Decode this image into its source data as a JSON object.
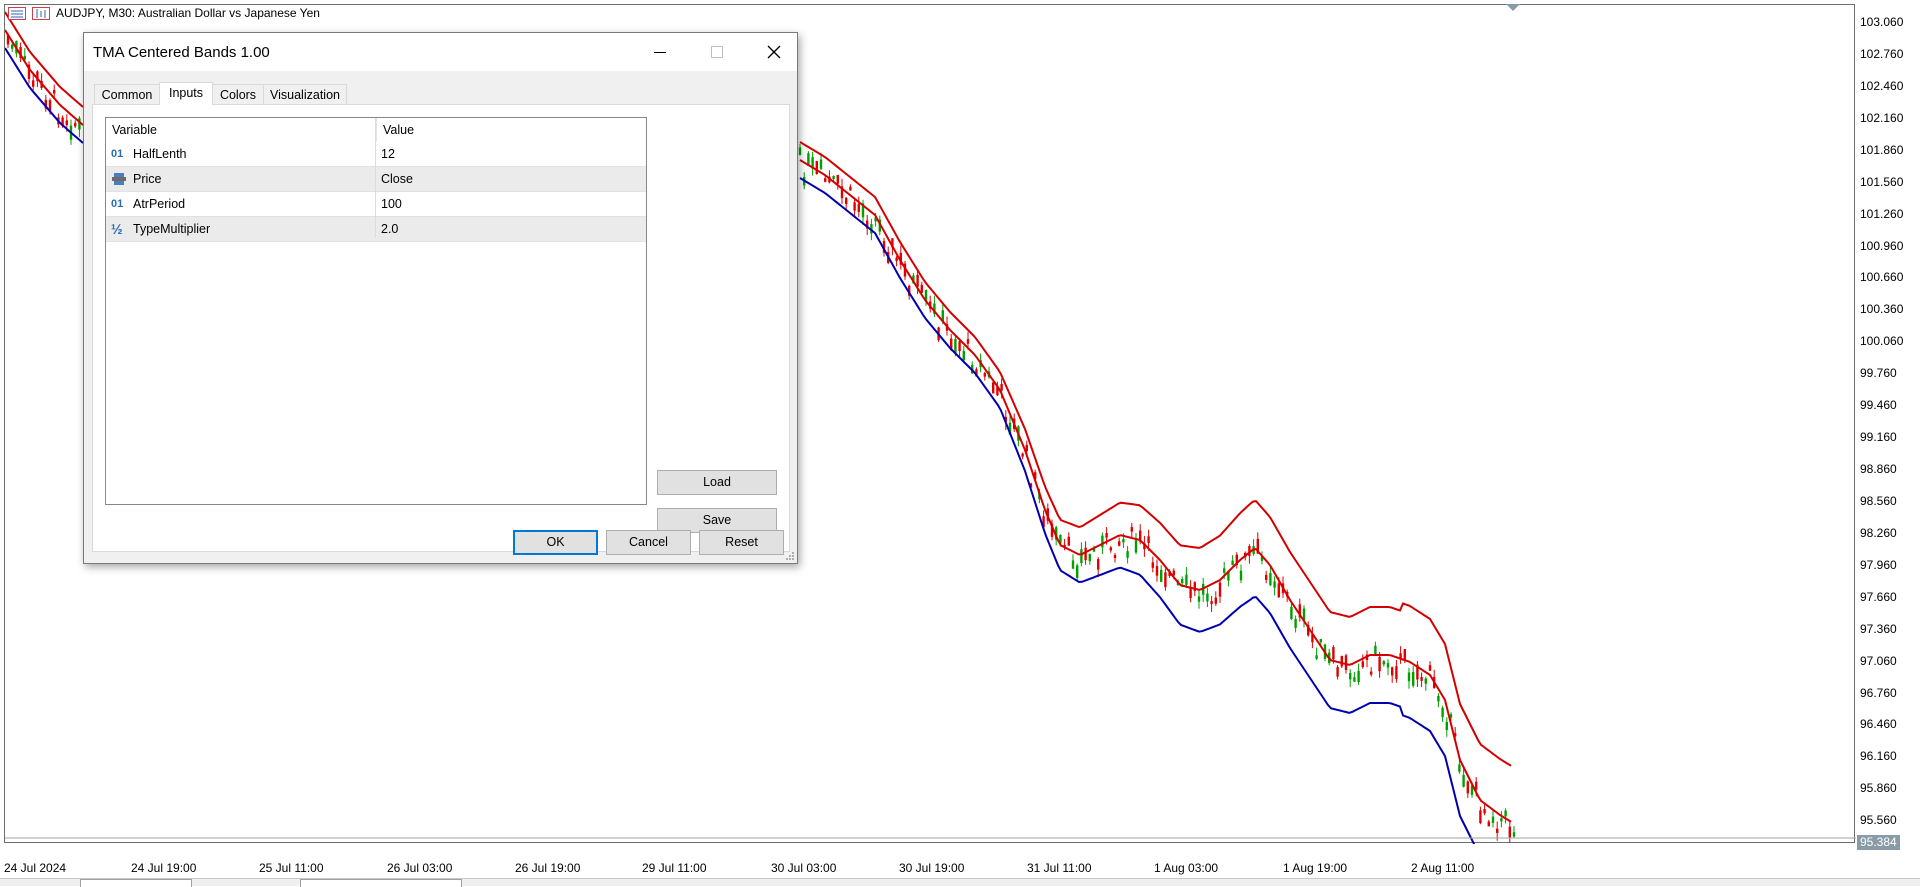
{
  "chart": {
    "symbol_title": "AUDJPY, M30:  Australian Dollar vs Japanese Yen",
    "current_price": "95.384",
    "price_labels": [
      "103.060",
      "102.760",
      "102.460",
      "102.160",
      "101.860",
      "101.560",
      "101.260",
      "100.960",
      "100.660",
      "100.360",
      "100.060",
      "99.760",
      "99.460",
      "99.160",
      "98.860",
      "98.560",
      "98.260",
      "97.960",
      "97.660",
      "97.360",
      "97.060",
      "96.760",
      "96.460",
      "96.160",
      "95.860",
      "95.560"
    ],
    "time_labels": [
      "24 Jul 2024",
      "24 Jul 19:00",
      "25 Jul 11:00",
      "26 Jul 03:00",
      "26 Jul 19:00",
      "29 Jul 11:00",
      "30 Jul 03:00",
      "30 Jul 19:00",
      "31 Jul 11:00",
      "1 Aug 03:00",
      "1 Aug 19:00",
      "2 Aug 11:00"
    ],
    "colors": {
      "bull": "#00a000",
      "bear": "#e00000",
      "upper_band": "#d40000",
      "middle_band": "#d40000",
      "lower_band": "#0000b0"
    }
  },
  "dialog": {
    "title": "TMA Centered Bands 1.00",
    "tabs": [
      {
        "label": "Common",
        "active": false
      },
      {
        "label": "Inputs",
        "active": true
      },
      {
        "label": "Colors",
        "active": false
      },
      {
        "label": "Visualization",
        "active": false
      }
    ],
    "grid": {
      "col_variable": "Variable",
      "col_value": "Value",
      "rows": [
        {
          "type_icon": "integer-icon",
          "type_glyph": "01",
          "variable": "HalfLenth",
          "value": "12"
        },
        {
          "type_icon": "enum-icon",
          "type_glyph": "",
          "variable": "Price",
          "value": "Close"
        },
        {
          "type_icon": "integer-icon",
          "type_glyph": "01",
          "variable": "AtrPeriod",
          "value": "100"
        },
        {
          "type_icon": "double-icon",
          "type_glyph": "½",
          "variable": "TypeMultiplier",
          "value": "2.0"
        }
      ]
    },
    "buttons": {
      "load": "Load",
      "save": "Save",
      "ok": "OK",
      "cancel": "Cancel",
      "reset": "Reset"
    }
  }
}
